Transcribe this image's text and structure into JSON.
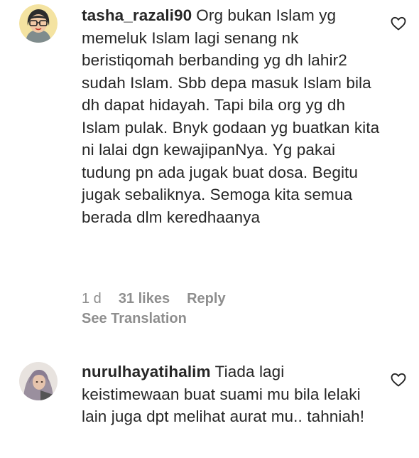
{
  "comments": [
    {
      "username": "tasha_razali90",
      "text": "Org bukan Islam yg memeluk Islam lagi senang nk beristiqomah berbanding yg dh lahir2 sudah Islam. Sbb depa masuk Islam bila dh dapat hidayah. Tapi bila org yg dh Islam pulak. Bnyk godaan yg buatkan kita ni lalai dgn kewajipanNya. Yg pakai tudung pn ada jugak buat dosa. Begitu jugak sebaliknya. Semoga kita semua berada dlm keredhaanya",
      "time": "1 d",
      "likes": "31 likes",
      "reply_label": "Reply",
      "see_translation": "See Translation",
      "avatar_icon": "cartoon-avatar-icon",
      "like_icon": "heart-outline-icon"
    },
    {
      "username": "nurulhayatihalim",
      "text": "Tiada lagi keistimewaan buat suami mu bila lelaki lain juga dpt melihat aurat mu.. tahniah!",
      "avatar_icon": "photo-avatar-icon",
      "like_icon": "heart-outline-icon"
    }
  ],
  "colors": {
    "text": "#262626",
    "muted": "#8e8e8e",
    "background": "#ffffff"
  }
}
